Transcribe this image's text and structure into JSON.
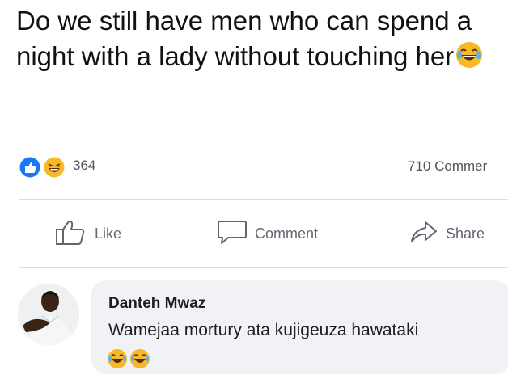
{
  "post": {
    "text": "Do we still have men who can spend a night with a lady without touching her",
    "emoji": "face-with-tears-of-joy"
  },
  "reactions": {
    "icons": [
      "like-reaction-icon",
      "haha-reaction-icon"
    ],
    "count": "364",
    "comments_count": "710 Commer"
  },
  "actions": {
    "like_label": "Like",
    "comment_label": "Comment",
    "share_label": "Share"
  },
  "comment": {
    "author": "Danteh Mwaz",
    "text": "Wamejaa mortury ata kujigeuza hawataki",
    "emojis": [
      "face-with-tears-of-joy",
      "face-with-tears-of-joy"
    ]
  },
  "colors": {
    "like_blue": "#1877f2",
    "haha_yellow": "#f7b928",
    "action_gray": "#606770",
    "bubble_bg": "#f0f2f5"
  }
}
